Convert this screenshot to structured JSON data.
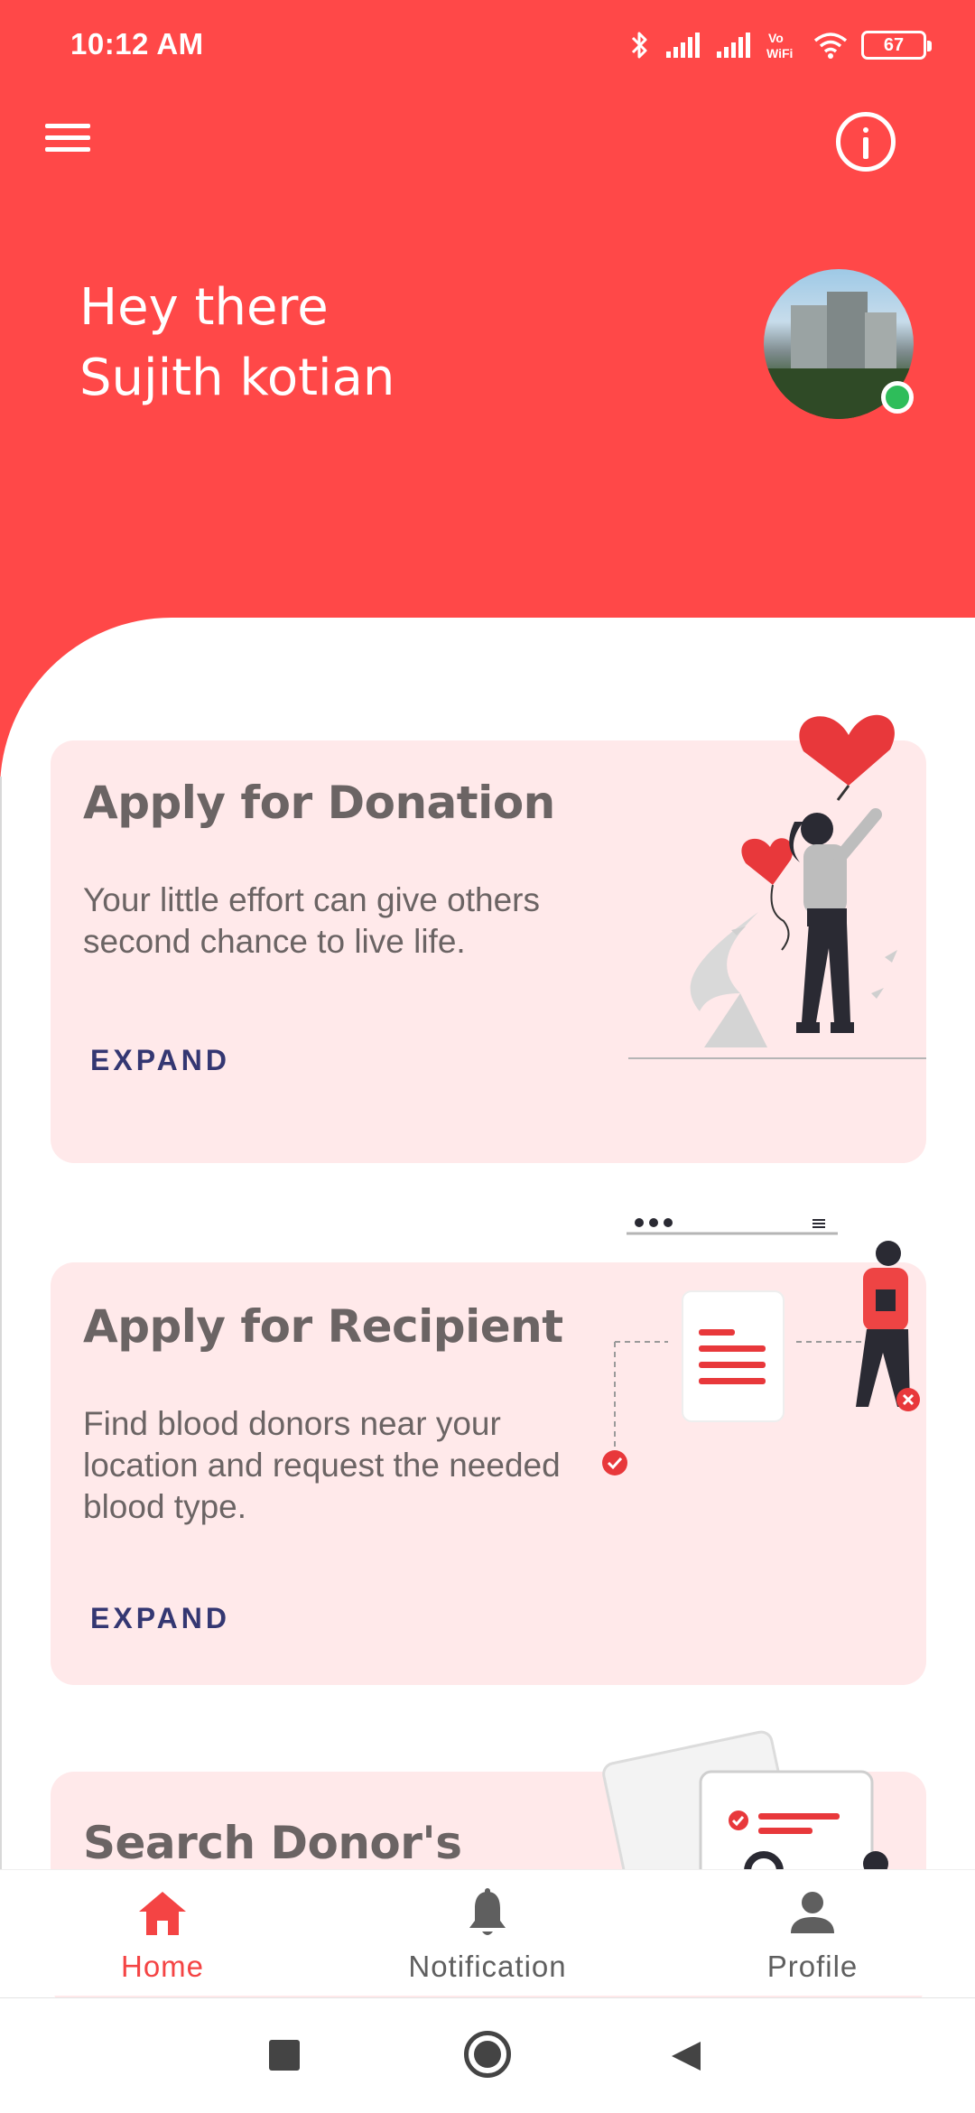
{
  "status_bar": {
    "time": "10:12 AM",
    "battery": "67",
    "icons": [
      "bluetooth-icon",
      "signal-icon",
      "signal-icon",
      "vowifi-icon",
      "wifi-icon",
      "battery-icon"
    ]
  },
  "header": {
    "menu_icon": "hamburger-menu-icon",
    "info_icon": "info-icon",
    "greeting_line1": "Hey there",
    "greeting_line2": "Sujith kotian",
    "avatar": "user-avatar",
    "status": "online"
  },
  "cards": [
    {
      "title": "Apply for Donation",
      "description": "Your little effort can give others second chance to live life.",
      "button": "EXPAND",
      "illustration": "woman-with-heart-balloons-illustration"
    },
    {
      "title": "Apply for Recipient",
      "description": "Find blood donors near your location and request the needed blood type.",
      "button": "EXPAND",
      "illustration": "request-document-illustration"
    },
    {
      "title": "Search Donor's",
      "illustration": "search-documents-illustration"
    }
  ],
  "bottom_nav": {
    "items": [
      {
        "label": "Home",
        "icon": "home-icon",
        "active": true
      },
      {
        "label": "Notification",
        "icon": "bell-icon",
        "active": false
      },
      {
        "label": "Profile",
        "icon": "person-icon",
        "active": false
      }
    ]
  },
  "system_nav": [
    "recents-square-icon",
    "home-circle-icon",
    "back-triangle-icon"
  ],
  "colors": {
    "primary": "#ff4848",
    "card_bg": "#ffe9ea",
    "button_text": "#343772",
    "text": "#6b6464",
    "online": "#2ebd5a",
    "nav_active": "#f44444"
  }
}
